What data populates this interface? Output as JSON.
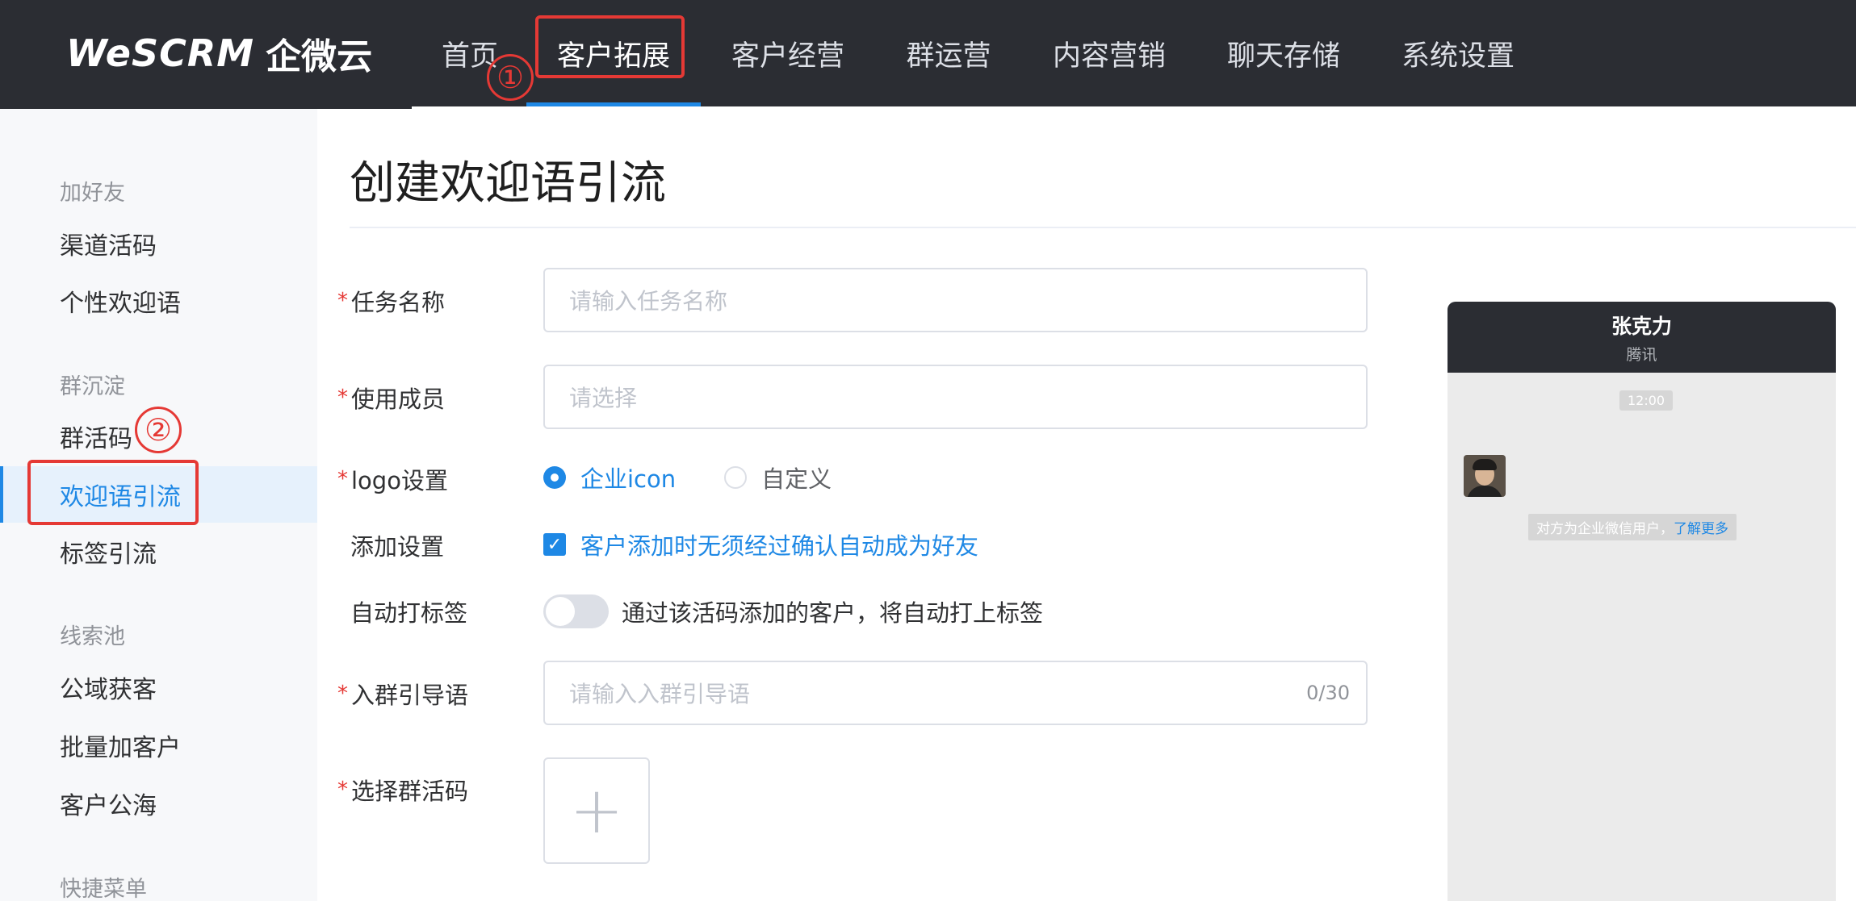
{
  "header": {
    "logo_mark": "WeSCRM",
    "logo_cn": "企微云",
    "nav": [
      {
        "label": "首页",
        "active": false
      },
      {
        "label": "客户拓展",
        "active": true
      },
      {
        "label": "客户经营",
        "active": false
      },
      {
        "label": "群运营",
        "active": false
      },
      {
        "label": "内容营销",
        "active": false
      },
      {
        "label": "聊天存储",
        "active": false
      },
      {
        "label": "系统设置",
        "active": false
      }
    ]
  },
  "sidebar": {
    "groups": [
      {
        "title": "加好友",
        "items": [
          "渠道活码",
          "个性欢迎语"
        ]
      },
      {
        "title": "群沉淀",
        "items": [
          "群活码",
          "欢迎语引流",
          "标签引流"
        ]
      },
      {
        "title": "线索池",
        "items": [
          "公域获客",
          "批量加客户",
          "客户公海"
        ]
      },
      {
        "title": "快捷菜单",
        "items": []
      }
    ],
    "active_item": "欢迎语引流"
  },
  "annotations": {
    "step1": "①",
    "step2": "②"
  },
  "main": {
    "title": "创建欢迎语引流",
    "form": {
      "task_name": {
        "label": "任务名称",
        "placeholder": "请输入任务名称"
      },
      "members": {
        "label": "使用成员",
        "placeholder": "请选择"
      },
      "logo": {
        "label": "logo设置",
        "options": [
          "企业icon",
          "自定义"
        ],
        "selected": "企业icon"
      },
      "add_setting": {
        "label": "添加设置",
        "checkbox_label": "客户添加时无须经过确认自动成为好友",
        "checked": true
      },
      "auto_tag": {
        "label": "自动打标签",
        "switch_label": "通过该活码添加的客户，将自动打上标签",
        "on": false
      },
      "group_guide": {
        "label": "入群引导语",
        "placeholder": "请输入入群引导语",
        "counter": "0/30"
      },
      "group_code": {
        "label": "选择群活码"
      }
    }
  },
  "preview": {
    "name": "张克力",
    "org": "腾讯",
    "time": "12:00",
    "notice_text": "对方为企业微信用户，",
    "notice_link": "了解更多"
  },
  "colors": {
    "topbar": "#2b2d33",
    "accent": "#1e88e5",
    "annotation": "#e53935"
  }
}
